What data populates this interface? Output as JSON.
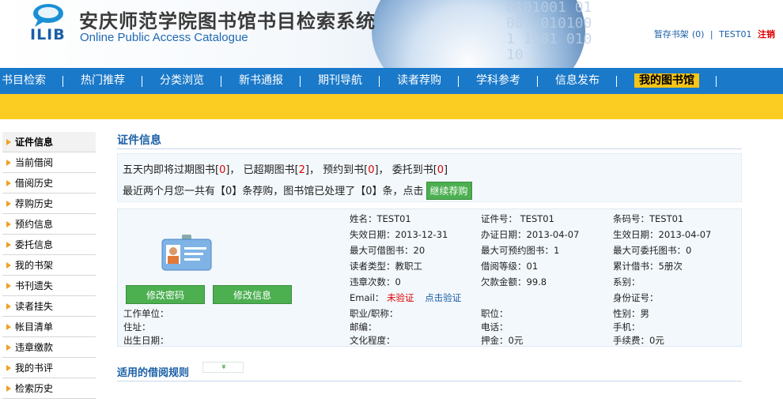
{
  "header": {
    "logo_text": "ILIB",
    "title": "安庆师范学院图书馆书目检索系统",
    "subtitle": "Online Public Access Catalogue",
    "binary_deco": "0101001 01001 0101001 1001 01010",
    "shelf_link": "暂存书架",
    "shelf_count": "(0)",
    "separator": "|",
    "user": "TEST01",
    "logout": "注销"
  },
  "nav": {
    "items": [
      "书目检索",
      "热门推荐",
      "分类浏览",
      "新书通报",
      "期刊导航",
      "读者荐购",
      "学科参考",
      "信息发布",
      "我的图书馆"
    ],
    "active_index": 8
  },
  "sidebar": {
    "items": [
      "证件信息",
      "当前借阅",
      "借阅历史",
      "荐购历史",
      "预约信息",
      "委托信息",
      "我的书架",
      "书刊遗失",
      "读者挂失",
      "帐目清单",
      "违章缴款",
      "我的书评",
      "检索历史"
    ],
    "active_index": 0
  },
  "main": {
    "title": "证件信息",
    "notice": {
      "line1_a": "五天内即将过期图书[",
      "overdue_soon": "0",
      "line1_b": "]，  已超期图书[",
      "overdue": "2",
      "line1_c": "]，  预约到书[",
      "reserved": "0",
      "line1_d": "]，   委托到书[",
      "entrusted": "0",
      "line1_e": "]",
      "line2": "最近两个月您一共有【0】条荐购，图书馆已处理了【0】条，点击",
      "continue_button": "继续荐购"
    },
    "buttons": {
      "change_password": "修改密码",
      "change_info": "修改信息"
    },
    "fields": {
      "name": "姓名：TEST01",
      "card_no": "证件号： TEST01",
      "barcode": "条码号：TEST01",
      "expire": "失效日期：2013-12-31",
      "issue": "办证日期：2013-04-07",
      "effective": "生效日期：2013-04-07",
      "max_borrow": "最大可借图书：20",
      "max_reserve": "最大可预约图书：1",
      "max_entrust": "最大可委托图书：0",
      "reader_type": "读者类型：教职工",
      "borrow_level": "借阅等级：01",
      "total_borrow": "累计借书：5册次",
      "violations": "违章次数：0",
      "debt": "欠款金额：99.8",
      "department": "系别：",
      "email_label": "Email：",
      "email_status": "未验证",
      "email_verify": "点击验证",
      "id_number": "身份证号：",
      "work_unit": "工作单位：",
      "title_pos": "职业/职称：",
      "position": "职位：",
      "gender": "性别：男",
      "address": "住址：",
      "postcode": "邮编：",
      "phone": "电话：",
      "mobile": "手机：",
      "birthday": "出生日期：",
      "education": "文化程度：",
      "deposit": "押金：0元",
      "fee": "手续费：0元"
    },
    "rules_title": "适用的借阅规则",
    "rules_toggle": "»"
  },
  "colors": {
    "nav_bg": "#1a79c9",
    "yellow_bar": "#fbcd23",
    "accent_blue": "#1a5fa6",
    "button_green": "#4caf50",
    "warning_red": "#dd0000"
  }
}
